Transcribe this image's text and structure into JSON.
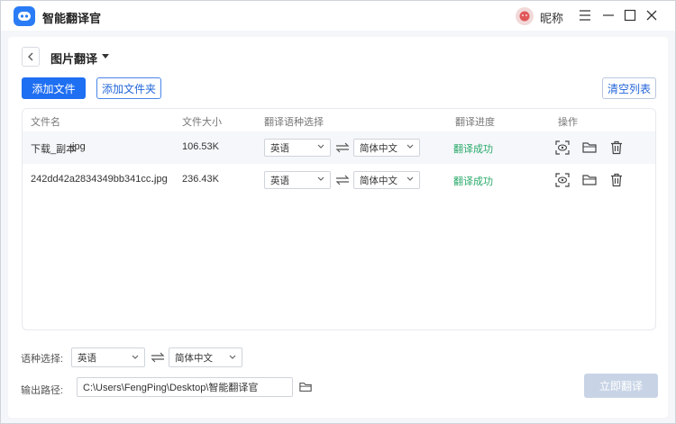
{
  "app": {
    "title": "智能翻译官",
    "nickname": "昵称"
  },
  "toolbar": {
    "page_title": "图片翻译",
    "add_file": "添加文件",
    "add_folder": "添加文件夹",
    "clear_list": "清空列表"
  },
  "table": {
    "headers": {
      "name": "文件名",
      "size": "文件大小",
      "lang": "翻译语种选择",
      "progress": "翻译进度",
      "actions": "操作"
    },
    "rows": [
      {
        "name": "下载_副本",
        "ext": ".jpg",
        "size": "106.53K",
        "source_lang": "英语",
        "target_lang": "简体中文",
        "status": "翻译成功"
      },
      {
        "name": "242dd42a2834349bb341cc...",
        "ext": ".jpg",
        "size": "236.43K",
        "source_lang": "英语",
        "target_lang": "简体中文",
        "status": "翻译成功"
      }
    ]
  },
  "bottom": {
    "lang_label": "语种选择:",
    "source_lang": "英语",
    "target_lang": "简体中文",
    "output_label": "输出路径:",
    "output_path": "C:\\Users\\FengPing\\Desktop\\智能翻译官",
    "start_button": "立即翻译"
  },
  "colors": {
    "primary": "#1f6ff2",
    "success": "#2aaa6a",
    "disabled_button": "#c8d4e6"
  },
  "icons": {
    "logo": "robot-icon",
    "back": "chevron-left-icon",
    "swap": "swap-icon",
    "preview": "preview-icon",
    "folder": "folder-icon",
    "delete": "trash-icon"
  }
}
